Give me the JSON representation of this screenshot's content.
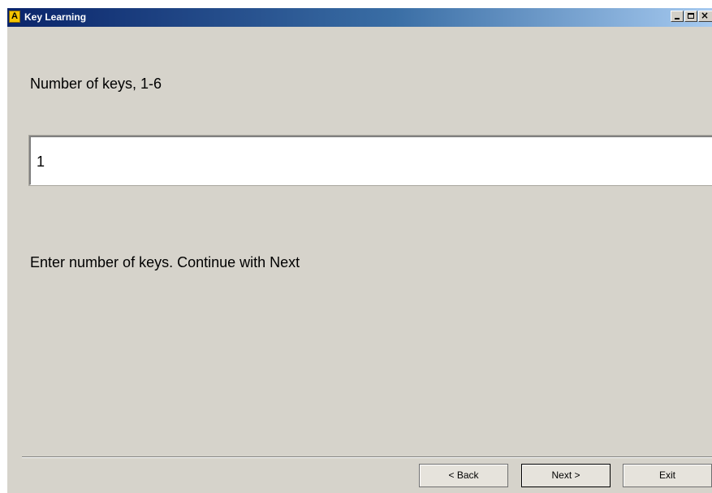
{
  "window": {
    "icon_letter": "A",
    "title": "Key Learning"
  },
  "form": {
    "prompt": "Number of keys, 1-6",
    "keys_value": "1",
    "instruction": "Enter number of keys. Continue with Next"
  },
  "buttons": {
    "back": "< Back",
    "next": "Next >",
    "exit": "Exit"
  },
  "icons": {
    "minimize": "minimize-icon",
    "maximize": "maximize-icon",
    "close": "close-icon"
  },
  "colors": {
    "titlebar_start": "#0a246a",
    "titlebar_end": "#a6caf0",
    "window_bg": "#d6d3cb"
  }
}
